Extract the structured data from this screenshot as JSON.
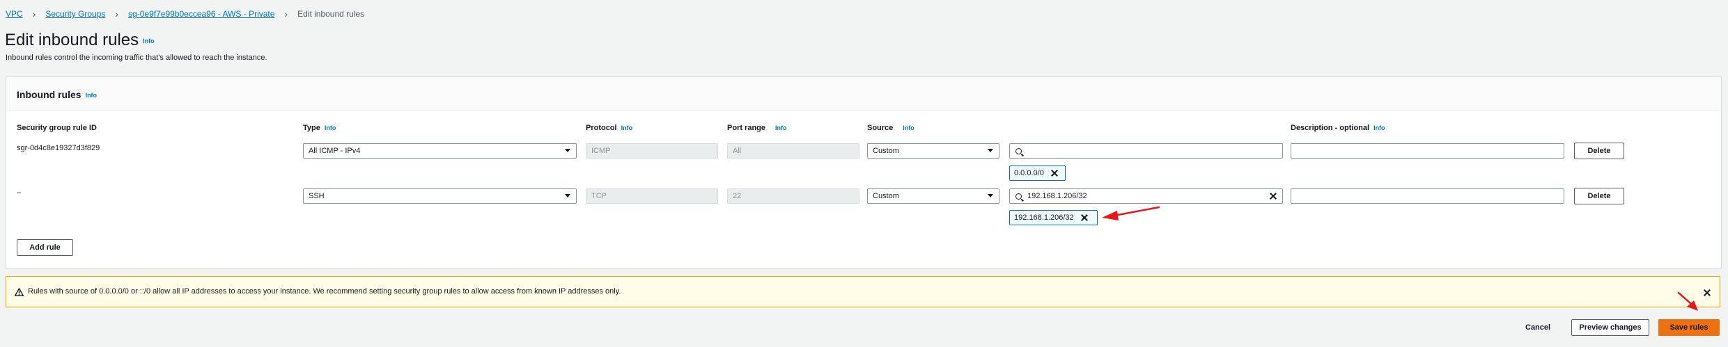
{
  "breadcrumb": {
    "items": [
      "VPC",
      "Security Groups",
      "sg-0e9f7e99b0eccea96 - AWS - Private"
    ],
    "current": "Edit inbound rules"
  },
  "page": {
    "title": "Edit inbound rules",
    "info": "Info",
    "subtitle": "Inbound rules control the incoming traffic that's allowed to reach the instance."
  },
  "panel": {
    "title": "Inbound rules",
    "info": "Info",
    "columns": {
      "rule_id": "Security group rule ID",
      "type": "Type",
      "protocol": "Protocol",
      "port_range": "Port range",
      "source": "Source",
      "description": "Description - optional",
      "info": "Info"
    },
    "rows": [
      {
        "rule_id": "sgr-0d4c8e19327d3f829",
        "type": "All ICMP - IPv4",
        "protocol": "ICMP",
        "port_range": "All",
        "source": "Custom",
        "search_value": "",
        "token": "0.0.0.0/0",
        "description": "",
        "delete_label": "Delete"
      },
      {
        "rule_id": "–",
        "type": "SSH",
        "protocol": "TCP",
        "port_range": "22",
        "source": "Custom",
        "search_value": "192.168.1.206/32",
        "token": "192.168.1.206/32",
        "description": "",
        "delete_label": "Delete"
      }
    ],
    "add_rule_label": "Add rule"
  },
  "warning": {
    "text": "Rules with source of 0.0.0.0/0 or ::/0 allow all IP addresses to access your instance. We recommend setting security group rules to allow access from known IP addresses only."
  },
  "footer": {
    "cancel_label": "Cancel",
    "preview_label": "Preview changes",
    "save_label": "Save rules"
  },
  "colors": {
    "accent": "#ec7211",
    "link": "#0073bb",
    "warning_border": "#ff9900",
    "annotation_arrow": "#e8151b"
  }
}
